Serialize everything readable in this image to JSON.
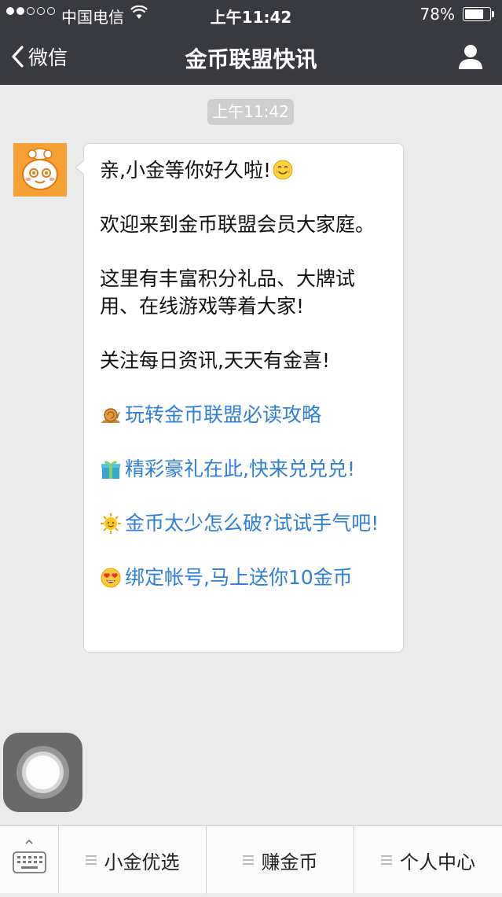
{
  "status_bar": {
    "carrier": "中国电信",
    "time": "上午11:42",
    "battery": "78%",
    "battery_level": 0.78
  },
  "nav": {
    "back_label": "微信",
    "title": "金币联盟快讯"
  },
  "chat": {
    "timestamp": "上午11:42",
    "message": {
      "greeting": "亲,小金等你好久啦!",
      "welcome": "欢迎来到金币联盟会员大家庭。",
      "intro": "这里有丰富积分礼品、大牌试用、在线游戏等着大家!",
      "follow": "关注每日资讯,天天有金喜!",
      "links": [
        {
          "icon": "snail-icon",
          "text": "玩转金币联盟必读攻略"
        },
        {
          "icon": "gift-icon",
          "text": "精彩豪礼在此,快来兑兑兑!"
        },
        {
          "icon": "sun-icon",
          "text": "金币太少怎么破?试试手气吧!"
        },
        {
          "icon": "heart-eyes-icon",
          "text": "绑定帐号,马上送你10金币"
        }
      ]
    }
  },
  "bottom_menu": {
    "items": [
      {
        "label": "小金优选"
      },
      {
        "label": "赚金币"
      },
      {
        "label": "个人中心"
      }
    ]
  },
  "colors": {
    "navbar": "#393a3f",
    "background": "#ebebeb",
    "link": "#2f7ed8",
    "avatar": "#f7a034"
  }
}
